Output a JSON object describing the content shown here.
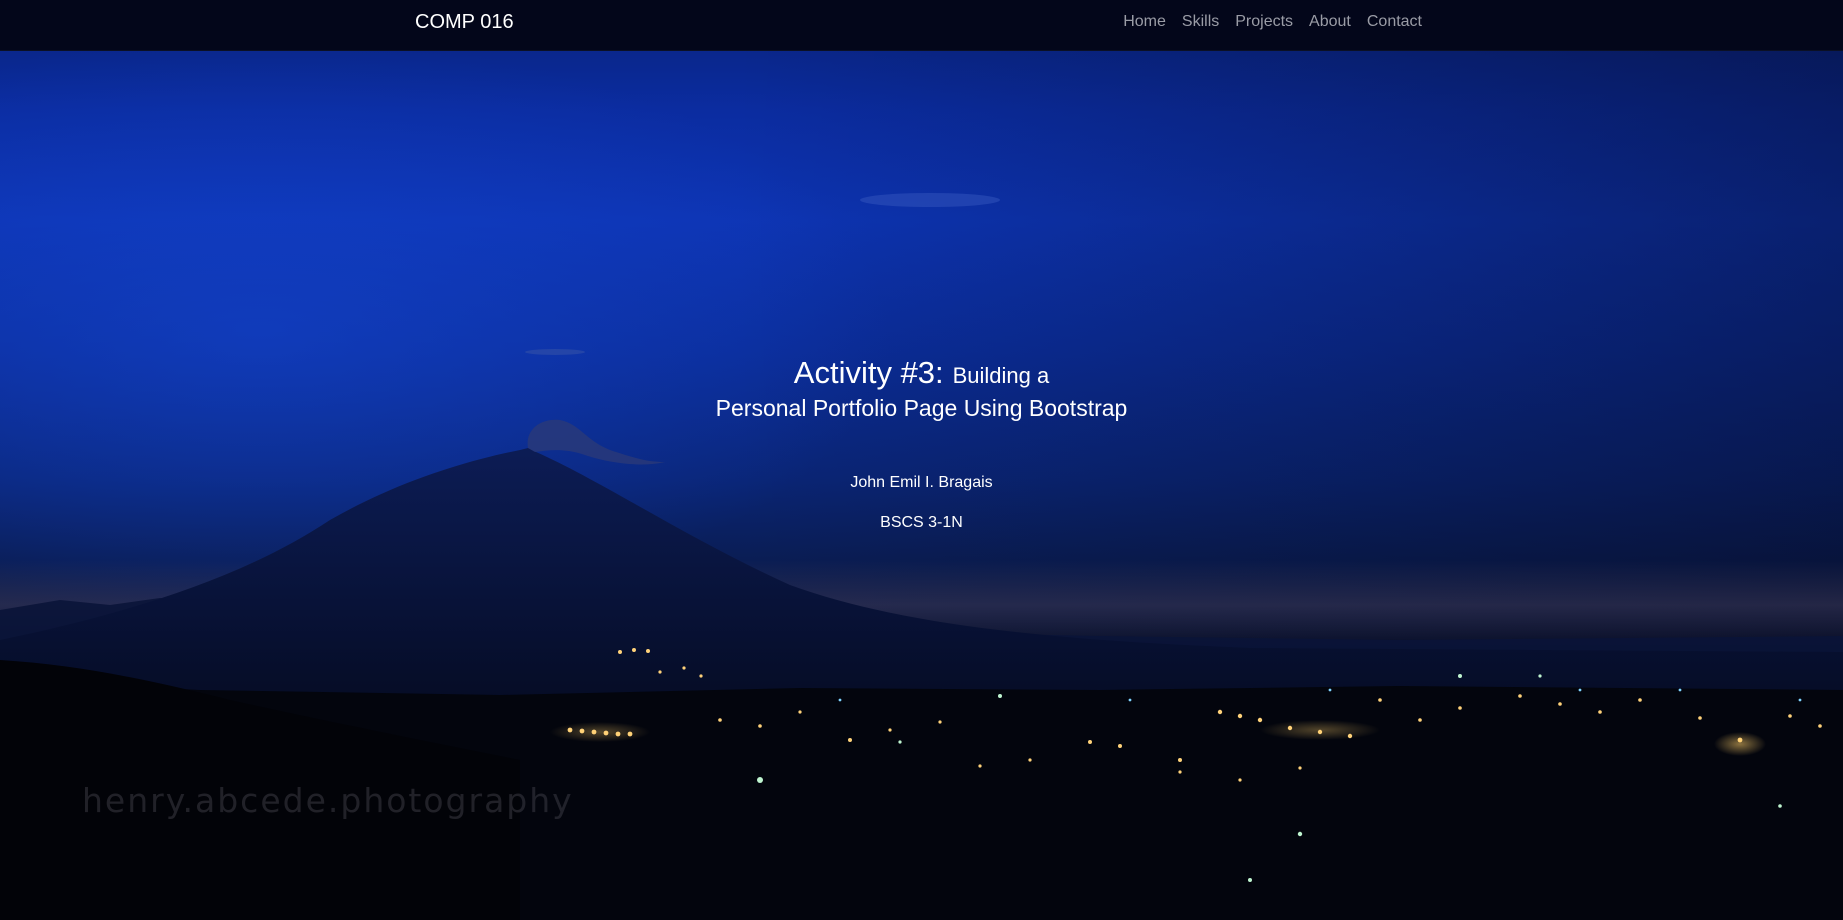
{
  "navbar": {
    "brand": "COMP 016",
    "links": [
      "Home",
      "Skills",
      "Projects",
      "About",
      "Contact"
    ]
  },
  "hero": {
    "title_big": "Activity #3:",
    "title_small": "Building a",
    "title_line2": "Personal Portfolio Page Using Bootstrap",
    "name": "John Emil I. Bragais",
    "section": "BSCS 3-1N",
    "watermark": "henry.abcede.photography"
  },
  "colors": {
    "navbar_bg": "#03061a",
    "nav_link": "#9a9ca6",
    "brand_text": "#ffffff",
    "sky_top": "#0b2ca0",
    "sky_bottom": "#010205"
  }
}
